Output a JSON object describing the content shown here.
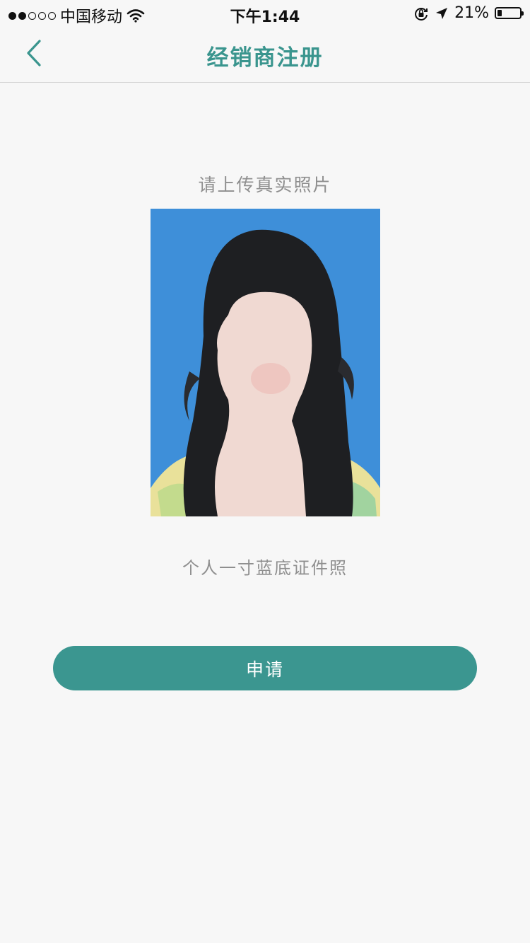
{
  "status_bar": {
    "carrier": "中国移动",
    "time": "下午1:44",
    "battery_percent_text": "21%",
    "battery_level": 0.21,
    "signal_bars": 2,
    "icons": [
      "signal-dots-icon",
      "wifi-icon",
      "rotation-lock-icon",
      "location-arrow-icon",
      "battery-icon"
    ]
  },
  "nav": {
    "title": "经销商注册",
    "back_icon": "chevron-left-icon"
  },
  "upload": {
    "title": "请上传真实照片",
    "caption": "个人一寸蓝底证件照"
  },
  "actions": {
    "apply_label": "申请"
  },
  "colors": {
    "accent": "#3a958e",
    "button": "#3b9690",
    "photo_background": "#3e8fd9",
    "hint_text": "#8f8f8f",
    "page_background": "#f7f7f7"
  }
}
